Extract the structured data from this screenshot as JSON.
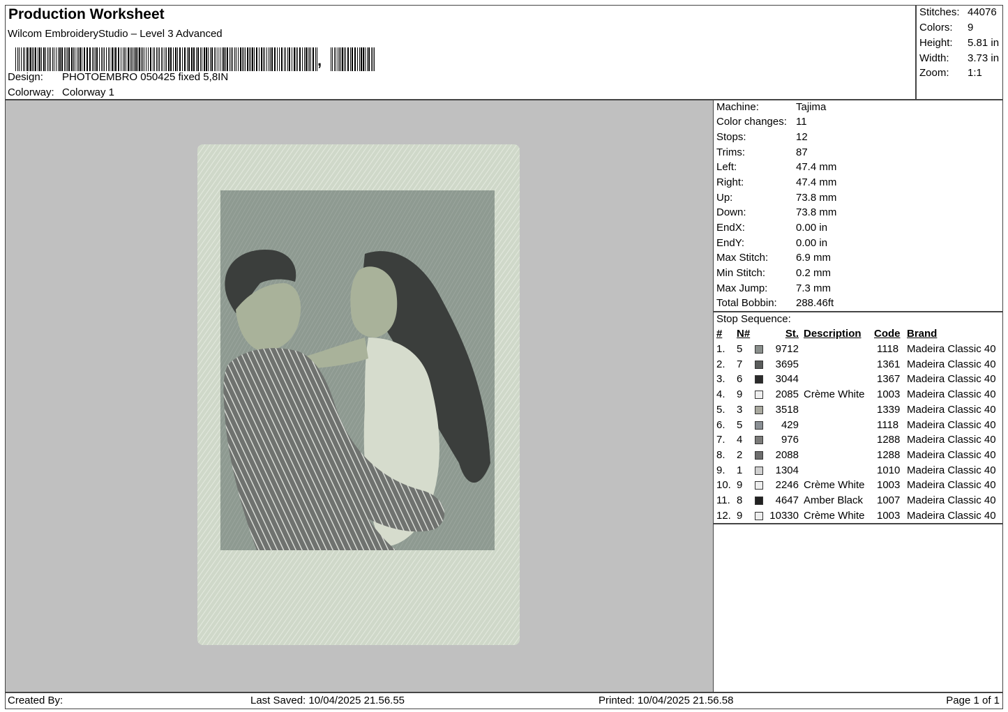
{
  "header": {
    "title": "Production Worksheet",
    "software": "Wilcom EmbroideryStudio – Level 3 Advanced",
    "barcode_suffix": ",",
    "design_label": "Design:",
    "design_value": "PHOTOEMBRO 050425 fixed 5,8IN",
    "colorway_label": "Colorway:",
    "colorway_value": "Colorway 1"
  },
  "stats": [
    {
      "label": "Stitches:",
      "value": "44076"
    },
    {
      "label": "Colors:",
      "value": "9"
    },
    {
      "label": "Height:",
      "value": "5.81 in"
    },
    {
      "label": "Width:",
      "value": "3.73 in"
    },
    {
      "label": "Zoom:",
      "value": "1:1"
    }
  ],
  "machine": [
    {
      "label": "Machine:",
      "value": "Tajima"
    },
    {
      "label": "Color changes:",
      "value": "11"
    },
    {
      "label": "Stops:",
      "value": "12"
    },
    {
      "label": "Trims:",
      "value": "87"
    },
    {
      "label": "Left:",
      "value": "47.4 mm"
    },
    {
      "label": "Right:",
      "value": "47.4 mm"
    },
    {
      "label": "Up:",
      "value": "73.8 mm"
    },
    {
      "label": "Down:",
      "value": "73.8 mm"
    },
    {
      "label": "EndX:",
      "value": "0.00 in"
    },
    {
      "label": "EndY:",
      "value": "0.00 in"
    },
    {
      "label": "Max Stitch:",
      "value": "6.9 mm"
    },
    {
      "label": "Min Stitch:",
      "value": "0.2 mm"
    },
    {
      "label": "Max Jump:",
      "value": "7.3 mm"
    },
    {
      "label": "Total Bobbin:",
      "value": "288.46ft"
    }
  ],
  "stop_sequence": {
    "title": "Stop Sequence:",
    "columns": {
      "num": "#",
      "n": "N#",
      "st": "St.",
      "description": "Description",
      "code": "Code",
      "brand": "Brand"
    },
    "rows": [
      {
        "num": "1.",
        "n": "5",
        "color": "#8a8f8c",
        "st": "9712",
        "description": "",
        "code": "1118",
        "brand": "Madeira Classic 40"
      },
      {
        "num": "2.",
        "n": "7",
        "color": "#5a5c5b",
        "st": "3695",
        "description": "",
        "code": "1361",
        "brand": "Madeira Classic 40"
      },
      {
        "num": "3.",
        "n": "6",
        "color": "#2b2b2b",
        "st": "3044",
        "description": "",
        "code": "1367",
        "brand": "Madeira Classic 40"
      },
      {
        "num": "4.",
        "n": "9",
        "color": "#eeeeee",
        "st": "2085",
        "description": "Crème White",
        "code": "1003",
        "brand": "Madeira Classic 40"
      },
      {
        "num": "5.",
        "n": "3",
        "color": "#a9a99f",
        "st": "3518",
        "description": "",
        "code": "1339",
        "brand": "Madeira Classic 40"
      },
      {
        "num": "6.",
        "n": "5",
        "color": "#8a8f94",
        "st": "429",
        "description": "",
        "code": "1118",
        "brand": "Madeira Classic 40"
      },
      {
        "num": "7.",
        "n": "4",
        "color": "#7a7a78",
        "st": "976",
        "description": "",
        "code": "1288",
        "brand": "Madeira Classic 40"
      },
      {
        "num": "8.",
        "n": "2",
        "color": "#6e6e6e",
        "st": "2088",
        "description": "",
        "code": "1288",
        "brand": "Madeira Classic 40"
      },
      {
        "num": "9.",
        "n": "1",
        "color": "#d0d0d0",
        "st": "1304",
        "description": "",
        "code": "1010",
        "brand": "Madeira Classic 40"
      },
      {
        "num": "10.",
        "n": "9",
        "color": "#eeeeee",
        "st": "2246",
        "description": "Crème White",
        "code": "1003",
        "brand": "Madeira Classic 40"
      },
      {
        "num": "11.",
        "n": "8",
        "color": "#222222",
        "st": "4647",
        "description": "Amber Black",
        "code": "1007",
        "brand": "Madeira Classic 40"
      },
      {
        "num": "12.",
        "n": "9",
        "color": "#eeeeee",
        "st": "10330",
        "description": "Crème White",
        "code": "1003",
        "brand": "Madeira Classic 40"
      }
    ]
  },
  "footer": {
    "created_by": "Created By:",
    "last_saved": "Last Saved: 10/04/2025 21.56.55",
    "printed": "Printed: 10/04/2025 21.56.58",
    "page": "Page 1 of 1"
  },
  "colors": {
    "canvas_bg": "#c0c0c0",
    "card_fill": "#cfd8c9",
    "photo_bg": "#8e9a91",
    "skin": "#a9b29a",
    "hair": "#3b3e3c"
  }
}
